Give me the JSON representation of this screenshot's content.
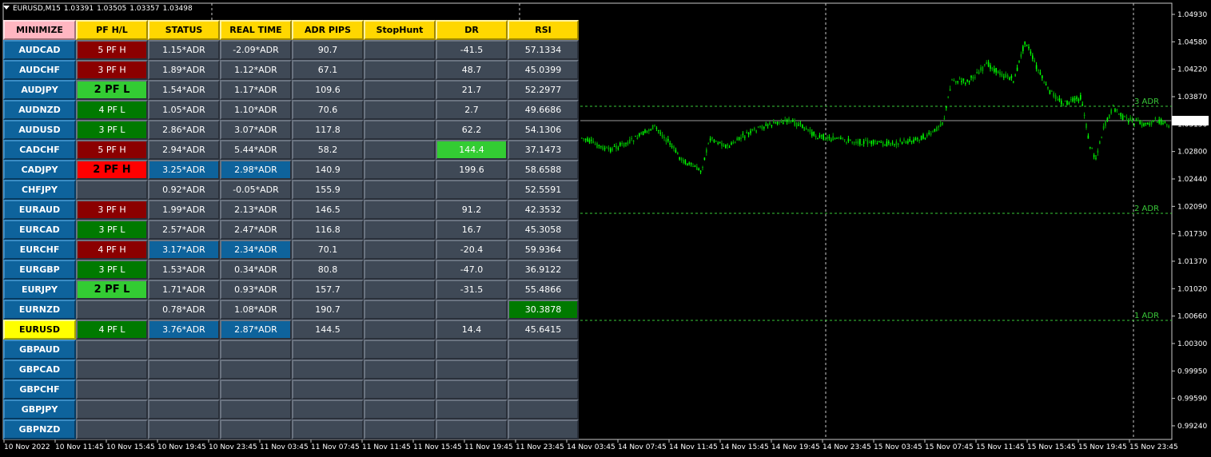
{
  "chart": {
    "symbol": "EURUSD,M15",
    "ohlc": [
      "1.03391",
      "1.03505",
      "1.03357",
      "1.03498"
    ],
    "current_price": "1.03498",
    "price_axis": [
      "1.04930",
      "1.04580",
      "1.04220",
      "1.03870",
      "1.03150",
      "1.02800",
      "1.02440",
      "1.02090",
      "1.01730",
      "1.01370",
      "1.01020",
      "1.00660",
      "1.00300",
      "0.99950",
      "0.99590",
      "0.99240"
    ],
    "time_axis": [
      "10 Nov 2022",
      "10 Nov 11:45",
      "10 Nov 15:45",
      "10 Nov 19:45",
      "10 Nov 23:45",
      "11 Nov 03:45",
      "11 Nov 07:45",
      "11 Nov 11:45",
      "11 Nov 15:45",
      "11 Nov 19:45",
      "11 Nov 23:45",
      "14 Nov 03:45",
      "14 Nov 07:45",
      "14 Nov 11:45",
      "14 Nov 15:45",
      "14 Nov 19:45",
      "14 Nov 23:45",
      "15 Nov 03:45",
      "15 Nov 07:45",
      "15 Nov 11:45",
      "15 Nov 15:45",
      "15 Nov 19:45",
      "15 Nov 23:45"
    ],
    "adr_labels": [
      "3 ADR",
      "2 ADR",
      "1 ADR"
    ],
    "colors": {
      "bull": "#00ff00",
      "bear": "#00aa00",
      "adr_line": "#39c739",
      "background": "#000000"
    }
  },
  "dashboard": {
    "headers": [
      "MINIMIZE",
      "PF H/L",
      "STATUS",
      "REAL TIME",
      "ADR PIPS",
      "StopHunt",
      "DR",
      "RSI"
    ],
    "rows": [
      {
        "pair": "AUDCAD",
        "pf": "5 PF H",
        "pf_color": "darkred",
        "status": "1.15*ADR",
        "realtime": "-2.09*ADR",
        "adr": "90.7",
        "stophunt": "",
        "dr": "-41.5",
        "rsi": "57.1334"
      },
      {
        "pair": "AUDCHF",
        "pf": "3 PF H",
        "pf_color": "darkred",
        "status": "1.89*ADR",
        "realtime": "1.12*ADR",
        "adr": "67.1",
        "stophunt": "",
        "dr": "48.7",
        "rsi": "45.0399"
      },
      {
        "pair": "AUDJPY",
        "pf": "2 PF L",
        "pf_color": "lime",
        "status": "1.54*ADR",
        "realtime": "1.17*ADR",
        "adr": "109.6",
        "stophunt": "",
        "dr": "21.7",
        "rsi": "52.2977"
      },
      {
        "pair": "AUDNZD",
        "pf": "4 PF L",
        "pf_color": "darkgreen",
        "status": "1.05*ADR",
        "realtime": "1.10*ADR",
        "adr": "70.6",
        "stophunt": "",
        "dr": "2.7",
        "rsi": "49.6686"
      },
      {
        "pair": "AUDUSD",
        "pf": "3 PF L",
        "pf_color": "darkgreen",
        "status": "2.86*ADR",
        "realtime": "3.07*ADR",
        "adr": "117.8",
        "stophunt": "",
        "dr": "62.2",
        "rsi": "54.1306"
      },
      {
        "pair": "CADCHF",
        "pf": "5 PF H",
        "pf_color": "darkred",
        "status": "2.94*ADR",
        "realtime": "5.44*ADR",
        "adr": "58.2",
        "stophunt": "",
        "dr": "144.4",
        "dr_color": "lime",
        "rsi": "37.1473"
      },
      {
        "pair": "CADJPY",
        "pf": "2 PF H",
        "pf_color": "red",
        "status": "3.25*ADR",
        "status_color": "blue",
        "realtime": "2.98*ADR",
        "realtime_color": "blue",
        "adr": "140.9",
        "stophunt": "",
        "dr": "199.6",
        "rsi": "58.6588"
      },
      {
        "pair": "CHFJPY",
        "pf": "",
        "status": "0.92*ADR",
        "realtime": "-0.05*ADR",
        "adr": "155.9",
        "stophunt": "",
        "dr": "",
        "rsi": "52.5591"
      },
      {
        "pair": "EURAUD",
        "pf": "3 PF H",
        "pf_color": "darkred",
        "status": "1.99*ADR",
        "realtime": "2.13*ADR",
        "adr": "146.5",
        "stophunt": "",
        "dr": "91.2",
        "rsi": "42.3532"
      },
      {
        "pair": "EURCAD",
        "pf": "3 PF L",
        "pf_color": "darkgreen",
        "status": "2.57*ADR",
        "realtime": "2.47*ADR",
        "adr": "116.8",
        "stophunt": "",
        "dr": "16.7",
        "rsi": "45.3058"
      },
      {
        "pair": "EURCHF",
        "pf": "4 PF H",
        "pf_color": "darkred",
        "status": "3.17*ADR",
        "status_color": "blue",
        "realtime": "2.34*ADR",
        "realtime_color": "blue",
        "adr": "70.1",
        "stophunt": "",
        "dr": "-20.4",
        "rsi": "59.9364"
      },
      {
        "pair": "EURGBP",
        "pf": "3 PF L",
        "pf_color": "darkgreen",
        "status": "1.53*ADR",
        "realtime": "0.34*ADR",
        "adr": "80.8",
        "stophunt": "",
        "dr": "-47.0",
        "rsi": "36.9122"
      },
      {
        "pair": "EURJPY",
        "pf": "2 PF L",
        "pf_color": "lime",
        "status": "1.71*ADR",
        "realtime": "0.93*ADR",
        "adr": "157.7",
        "stophunt": "",
        "dr": "-31.5",
        "rsi": "55.4866"
      },
      {
        "pair": "EURNZD",
        "pf": "",
        "status": "0.78*ADR",
        "realtime": "1.08*ADR",
        "adr": "190.7",
        "stophunt": "",
        "dr": "",
        "rsi": "30.3878",
        "rsi_color": "darkgreen"
      },
      {
        "pair": "EURUSD",
        "active": true,
        "pf": "4 PF L",
        "pf_color": "darkgreen",
        "status": "3.76*ADR",
        "status_color": "blue",
        "realtime": "2.87*ADR",
        "realtime_color": "blue",
        "adr": "144.5",
        "stophunt": "",
        "dr": "14.4",
        "rsi": "45.6415"
      },
      {
        "pair": "GBPAUD",
        "pf": "",
        "status": "",
        "realtime": "",
        "adr": "",
        "stophunt": "",
        "dr": "",
        "rsi": ""
      },
      {
        "pair": "GBPCAD",
        "pf": "",
        "status": "",
        "realtime": "",
        "adr": "",
        "stophunt": "",
        "dr": "",
        "rsi": ""
      },
      {
        "pair": "GBPCHF",
        "pf": "",
        "status": "",
        "realtime": "",
        "adr": "",
        "stophunt": "",
        "dr": "",
        "rsi": ""
      },
      {
        "pair": "GBPJPY",
        "pf": "",
        "status": "",
        "realtime": "",
        "adr": "",
        "stophunt": "",
        "dr": "",
        "rsi": ""
      },
      {
        "pair": "GBPNZD",
        "pf": "",
        "status": "",
        "realtime": "",
        "adr": "",
        "stophunt": "",
        "dr": "",
        "rsi": ""
      }
    ]
  }
}
